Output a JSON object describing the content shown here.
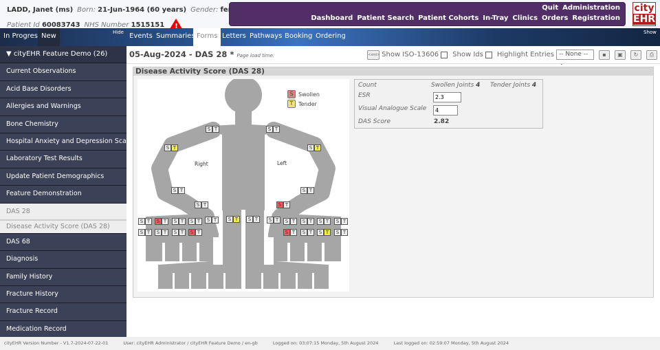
{
  "patient": {
    "name": "LADD,  Janet  (ms)",
    "born_label": "Born:",
    "born": "21-Jun-1964  (60 years)",
    "gender_label": "Gender:",
    "gender": "female",
    "id_label": "Patient Id",
    "id": "60083743",
    "nhs_label": "NHS Number",
    "nhs": "1515151"
  },
  "menu": {
    "row1": [
      "Quit",
      "Administration"
    ],
    "row2": [
      "Dashboard",
      "Patient Search",
      "Patient Cohorts",
      "In-Tray",
      "Clinics",
      "Orders",
      "Registration"
    ]
  },
  "logo": {
    "top": "city",
    "bottom": "EHR"
  },
  "nav": {
    "left": [
      "In Progress",
      "New"
    ],
    "hide": "Hide",
    "show": "Show",
    "tabs": [
      "Events",
      "Summaries",
      "Forms",
      "Letters",
      "Pathways",
      "Booking",
      "Ordering"
    ],
    "active": "Forms"
  },
  "sidebar": {
    "header": "▼ cityEHR Feature Demo (26)",
    "items": [
      "Current Observations",
      "Acid Base Disorders",
      "Allergies and Warnings",
      "Bone Chemistry",
      "Hospital Anxiety and Depression Scale",
      "Laboratory Test Results",
      "Update Patient Demographics",
      "Feature Demonstration"
    ],
    "selected": "DAS 28",
    "selected_form": "Disease Activity Score (DAS 28)",
    "items_after": [
      "DAS 68",
      "Diagnosis",
      "Family History",
      "Fracture History",
      "Fracture Record",
      "Medication Record"
    ]
  },
  "form": {
    "title": "05-Aug-2024 - DAS 28 *",
    "load_time": "Page load time:",
    "xml_btn": "<xml>",
    "show_iso": "Show ISO-13606",
    "show_ids": "Show Ids",
    "highlight": "Highlight Entries",
    "highlight_value": "-- None --",
    "section": "Disease Activity Score (DAS 28)"
  },
  "diagram": {
    "legend": {
      "swollen": "Swollen",
      "tender": "Tender",
      "s": "S",
      "t": "T"
    },
    "right": "Right",
    "left": "Left",
    "colors": {
      "swollen": "#e86060",
      "tender": "#f2ee4a",
      "body": "#a6a6a6"
    }
  },
  "results": {
    "count": "Count",
    "swollen_label": "Swollen Joints",
    "swollen": "4",
    "tender_label": "Tender Joints",
    "tender": "4",
    "esr_label": "ESR",
    "esr": "2.3",
    "vas_label": "Visual Analogue Scale",
    "vas": "4",
    "das_label": "DAS Score",
    "das": "2.82"
  },
  "footer": {
    "version": "cityEHR Version Number - V1.7-2024-07-22-01",
    "user": "User: cityEHR Administrator / cityEHR Feature Demo / en-gb",
    "logged": "Logged on: 03:07:15 Monday, 5th August 2024",
    "last": "Last logged on: 02:59:07 Monday, 5th August 2024"
  }
}
